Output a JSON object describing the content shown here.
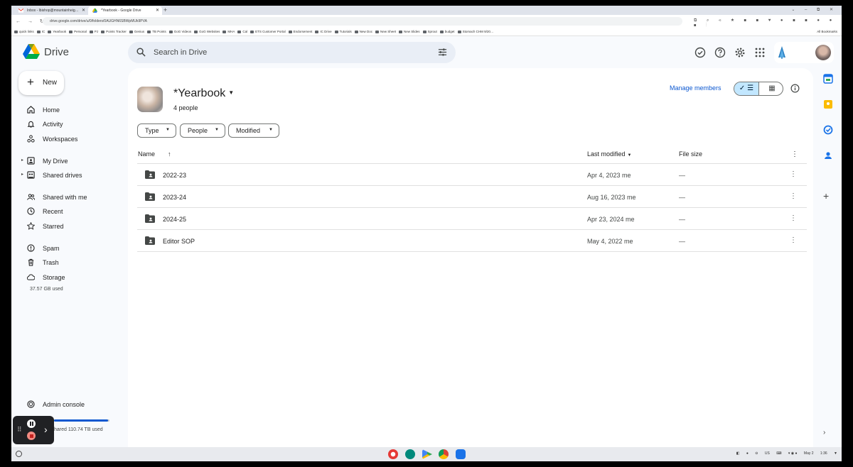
{
  "browser": {
    "tabs": [
      {
        "label": "Inbox - lbishop@mountainheig…",
        "active": false
      },
      {
        "label": "*Yearbook - Google Drive",
        "active": true
      }
    ],
    "url": "drive.google.com/drive/u/0/folders/0AUGHN6SBWpMUk9PVA",
    "bookmarks": [
      "quick links",
      "IC",
      "Yearbook",
      "Personal",
      "PJ",
      "Points Tracker",
      "Genius",
      "TB Points",
      "GoG Videos",
      "GoG Websites",
      "MHA",
      "Cal",
      "ETS Customer Portal",
      "Endorsement",
      "IC Drive",
      "Tutorials",
      "New Doc",
      "New Sheet",
      "New Slides",
      "Sprout",
      "budget",
      "Stomach CHM 9/20…"
    ],
    "all_bookmarks": "All Bookmarks"
  },
  "header": {
    "app_name": "Drive",
    "search_placeholder": "Search in Drive"
  },
  "sidebar": {
    "new_label": "New",
    "items": [
      {
        "label": "Home",
        "icon": "home-icon"
      },
      {
        "label": "Activity",
        "icon": "bell-icon"
      },
      {
        "label": "Workspaces",
        "icon": "workspaces-icon"
      },
      {
        "label": "My Drive",
        "icon": "my-drive-icon"
      },
      {
        "label": "Shared drives",
        "icon": "shared-drives-icon"
      },
      {
        "label": "Shared with me",
        "icon": "people-icon"
      },
      {
        "label": "Recent",
        "icon": "clock-icon"
      },
      {
        "label": "Starred",
        "icon": "star-icon"
      },
      {
        "label": "Spam",
        "icon": "spam-icon"
      },
      {
        "label": "Trash",
        "icon": "trash-icon"
      },
      {
        "label": "Storage",
        "icon": "cloud-icon"
      }
    ],
    "storage_used": "37.57 GB used",
    "admin_console": "Admin console",
    "shared_storage": "hared 110.74 TB used",
    "shared_storage_fraction": 0.98
  },
  "folder": {
    "title": "*Yearbook",
    "subtitle": "4 people",
    "manage_members": "Manage members"
  },
  "filters": [
    "Type",
    "People",
    "Modified"
  ],
  "table": {
    "columns": {
      "name": "Name",
      "modified": "Last modified",
      "size": "File size"
    },
    "rows": [
      {
        "name": "2022-23",
        "modified": "Apr 4, 2023 me",
        "size": "—"
      },
      {
        "name": "2023-24",
        "modified": "Aug 16, 2023 me",
        "size": "—"
      },
      {
        "name": "2024-25",
        "modified": "Apr 23, 2024 me",
        "size": "—"
      },
      {
        "name": "Editor SOP",
        "modified": "May 4, 2022 me",
        "size": "—"
      }
    ]
  },
  "shelf": {
    "tray_locale": "US",
    "date": "May 2",
    "time": "1:36"
  },
  "colors": {
    "accent": "#0b57d0",
    "selected_toggle": "#c2e7ff",
    "folder_icon": "#444746"
  }
}
